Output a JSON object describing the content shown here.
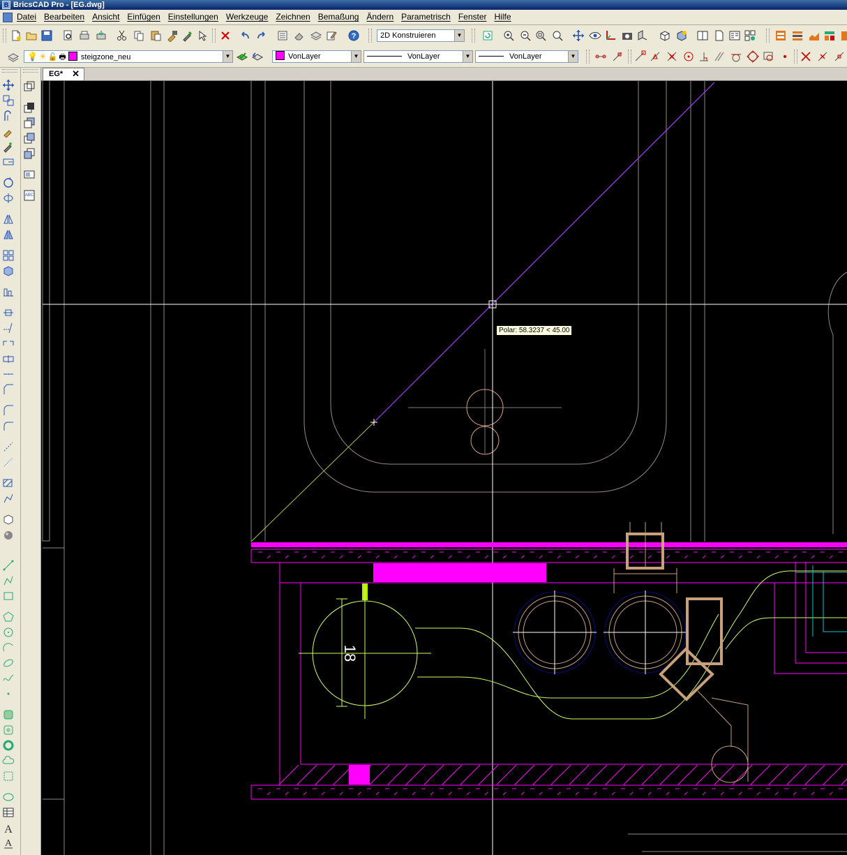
{
  "window": {
    "title": "BricsCAD Pro - [EG.dwg]"
  },
  "menu": [
    "Datei",
    "Bearbeiten",
    "Ansicht",
    "Einfügen",
    "Einstellungen",
    "Werkzeuge",
    "Zeichnen",
    "Bemaßung",
    "Ändern",
    "Parametrisch",
    "Fenster",
    "Hilfe"
  ],
  "workspace": {
    "value": "2D Konstruieren"
  },
  "layer": {
    "name": "steigzone_neu",
    "color": "#ff00ff"
  },
  "properties": {
    "color": "VonLayer",
    "linetype": "VonLayer",
    "lineweight": "VonLayer"
  },
  "tabs": [
    {
      "label": "EG*"
    }
  ],
  "canvas": {
    "tooltip": "Polar: 58.3237 < 45.00",
    "dimension_text": "18"
  },
  "colors": {
    "background": "#000000",
    "magenta": "#ff00ff",
    "yellowgreen": "#ccff66",
    "tan": "#c8a07a",
    "crosshair": "#ffffff"
  }
}
